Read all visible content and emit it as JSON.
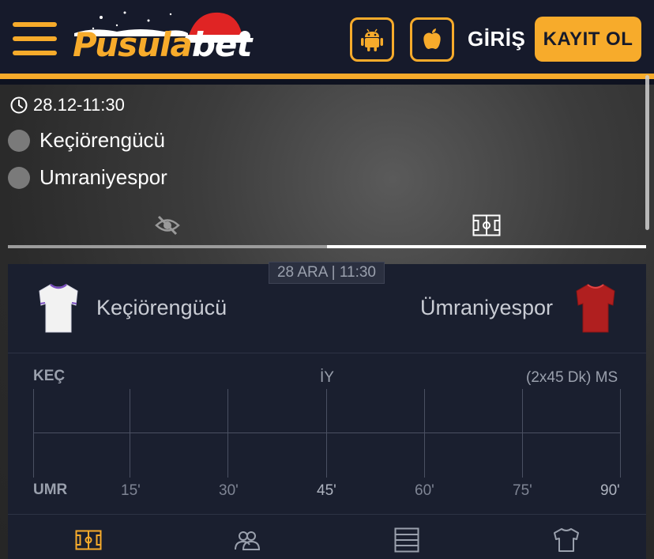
{
  "header": {
    "logo_text_a": "Pusula",
    "logo_text_b": "bet",
    "login_label": "GİRİŞ",
    "register_label": "KAYIT OL",
    "icons": [
      "menu-icon",
      "android-icon",
      "apple-icon"
    ]
  },
  "match": {
    "datetime": "28.12-11:30",
    "team_home": "Keçiörengücü",
    "team_away": "Umraniyespor",
    "tabs": [
      {
        "icon": "eye-off-icon",
        "active": false
      },
      {
        "icon": "field-icon",
        "active": true
      }
    ]
  },
  "scoreboard": {
    "date_badge": "28 ARA | 11:30",
    "home_name": "Keçiörengücü",
    "away_name": "Ümraniyespor",
    "home_short": "KEÇ",
    "away_short": "UMR",
    "half_label": "İY",
    "full_label": "(2x45 Dk) MS",
    "ticks": [
      "15'",
      "30'",
      "45'",
      "60'",
      "75'",
      "90'"
    ],
    "home_jersey_color": "#f2f2f2",
    "away_jersey_color": "#b01f1f"
  },
  "bottom_nav": {
    "icons": [
      "field-icon",
      "players-icon",
      "standings-icon",
      "jersey-icon"
    ],
    "active_index": 0
  },
  "colors": {
    "accent": "#f7ab2b",
    "header_bg": "#161a2b",
    "board_bg": "#1a1f2f"
  }
}
